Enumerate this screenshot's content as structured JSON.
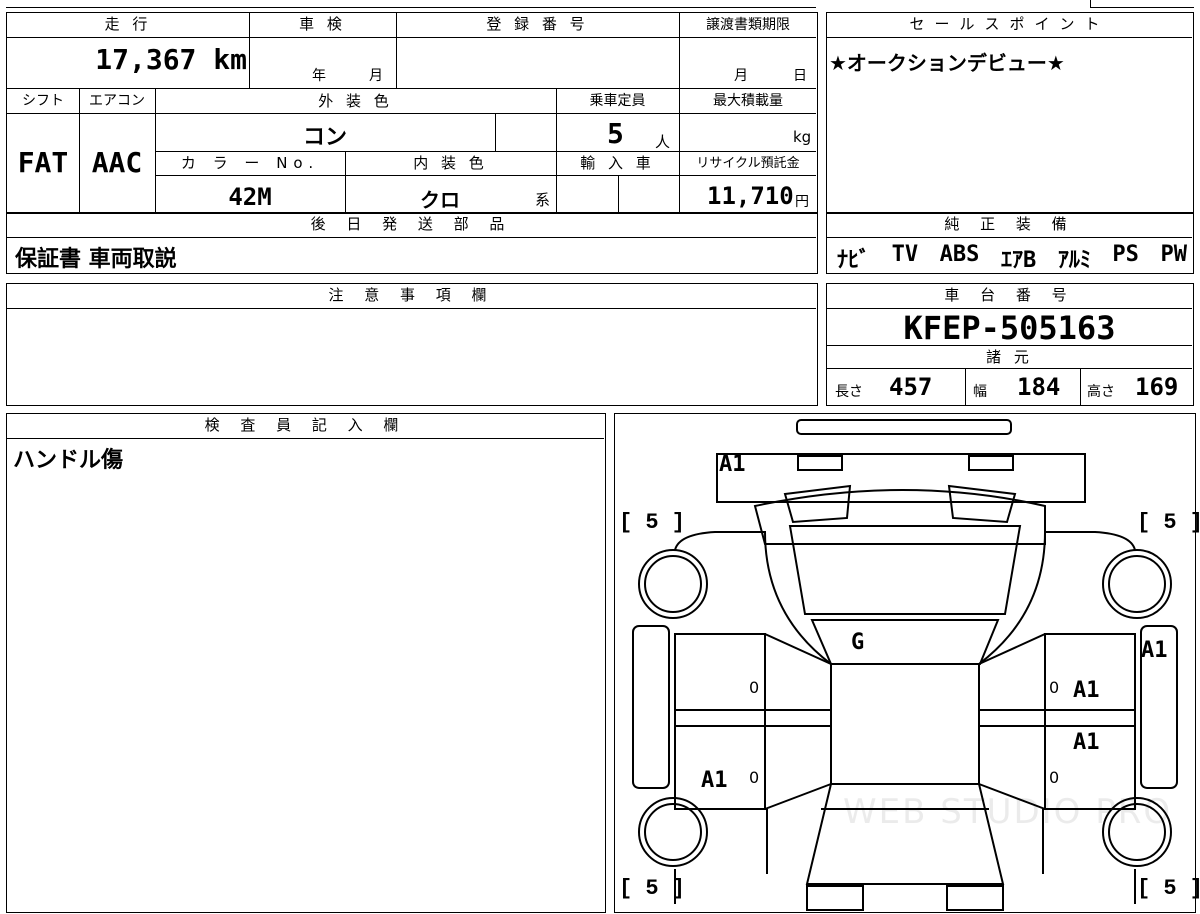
{
  "summary": {
    "mileage_label": "走 行",
    "mileage_value": "17,367",
    "mileage_unit": "km",
    "shaken_label": "車 検",
    "shaken_year_unit": "年",
    "shaken_month_unit": "月",
    "registration_label": "登 録 番 号",
    "transfer_deadline_label": "譲渡書類期限",
    "transfer_month_unit": "月",
    "transfer_day_unit": "日"
  },
  "specs": {
    "shift_label": "シフト",
    "shift_value": "FAT",
    "aircon_label": "エアコン",
    "aircon_value": "AAC",
    "exterior_color_label": "外 装 色",
    "exterior_color_value": "コン",
    "capacity_label": "乗車定員",
    "capacity_value": "5",
    "capacity_unit": "人",
    "max_load_label": "最大積載量",
    "max_load_unit": "kg",
    "color_no_label": "カ ラ ー No.",
    "color_no_value": "42M",
    "interior_color_label": "内 装 色",
    "interior_color_value": "クロ",
    "interior_color_suffix": "系",
    "import_label": "輸 入 車",
    "recycle_label": "リサイクル預託金",
    "recycle_value": "11,710",
    "recycle_unit": "円"
  },
  "later_parts": {
    "label": "後 日 発 送 部 品",
    "value": "保証書 車両取説"
  },
  "sales_point": {
    "label": "セールスポイント",
    "value": "★オークションデビュー★"
  },
  "equipment": {
    "label": "純 正 装 備",
    "items": [
      "ﾅﾋﾞ",
      "TV",
      "ABS",
      "ｴｱB",
      "ｱﾙﾐ",
      "PS",
      "PW"
    ]
  },
  "notes": {
    "label": "注 意 事 項 欄",
    "value": ""
  },
  "chassis": {
    "label": "車 台 番 号",
    "value": "KFEP-505163"
  },
  "dimensions": {
    "label": "諸 元",
    "length_label": "長さ",
    "length_value": "457",
    "width_label": "幅",
    "width_value": "184",
    "height_label": "高さ",
    "height_value": "169"
  },
  "inspector": {
    "label": "検 査 員 記 入 欄",
    "value": "ハンドル傷"
  },
  "diagram": {
    "tire_tl": "[ 5 ]",
    "tire_tr": "[ 5 ]",
    "tire_bl": "[ 5 ]",
    "tire_br": "[ 5 ]",
    "mark_front": "A1",
    "mark_hood": "G",
    "mark_right_side": "A1",
    "mark_right_front_door": "A1",
    "mark_right_rear_door": "A1",
    "mark_left_rear_door": "A1",
    "door_zero_1": "0",
    "door_zero_2": "0",
    "door_zero_3": "0",
    "door_zero_4": "0",
    "watermark": "WEB STUDIO PRO"
  }
}
